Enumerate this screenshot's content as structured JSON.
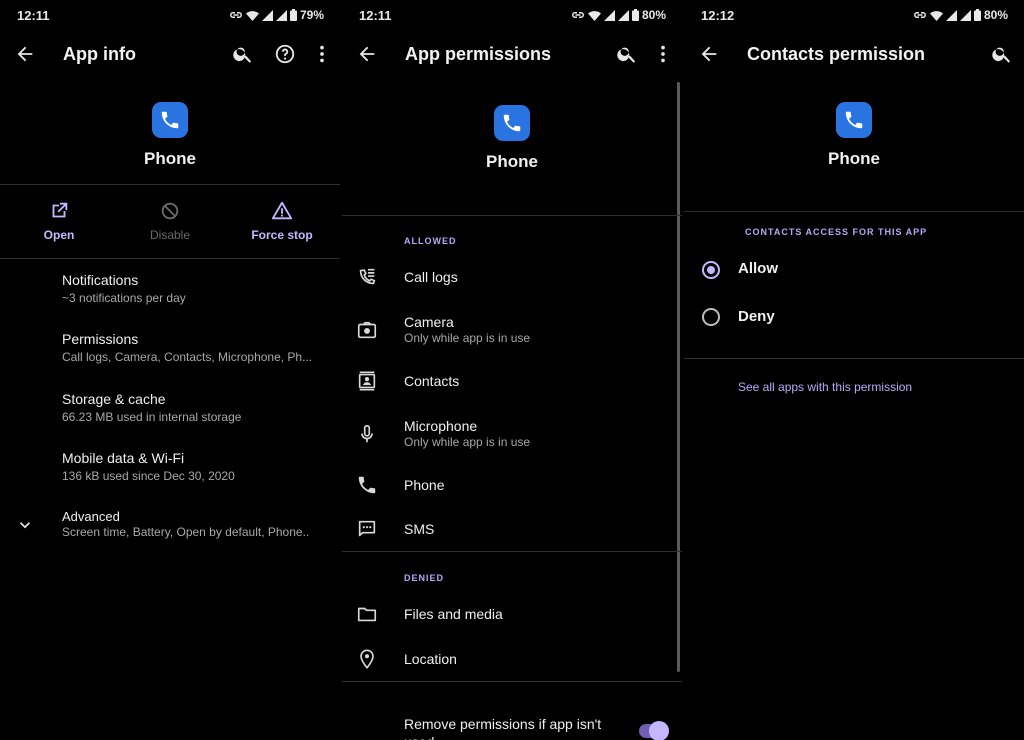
{
  "status_bars": [
    {
      "time": "12:11",
      "battery": "79%"
    },
    {
      "time": "12:11",
      "battery": "80%"
    },
    {
      "time": "12:12",
      "battery": "80%"
    }
  ],
  "colors": {
    "accent": "#c5b6ff",
    "app_icon_bg": "#2a74e2",
    "background": "#000000"
  },
  "app_info": {
    "title": "App info",
    "app_name": "Phone",
    "actions": [
      {
        "label": "Open",
        "icon": "open-external-icon",
        "enabled": true
      },
      {
        "label": "Disable",
        "icon": "disable-icon",
        "enabled": false
      },
      {
        "label": "Force stop",
        "icon": "warning-icon",
        "enabled": true
      }
    ],
    "items": [
      {
        "title": "Notifications",
        "subtitle": "~3 notifications per day"
      },
      {
        "title": "Permissions",
        "subtitle": "Call logs, Camera, Contacts, Microphone, Ph..."
      },
      {
        "title": "Storage & cache",
        "subtitle": "66.23 MB used in internal storage"
      },
      {
        "title": "Mobile data & Wi-Fi",
        "subtitle": "136 kB used since Dec 30, 2020"
      },
      {
        "title": "Advanced",
        "subtitle": "Screen time, Battery, Open by default, Phone.."
      }
    ]
  },
  "app_permissions": {
    "title": "App permissions",
    "app_name": "Phone",
    "allowed_header": "ALLOWED",
    "allowed": [
      {
        "title": "Call logs",
        "subtitle": "",
        "icon": "call-log-icon"
      },
      {
        "title": "Camera",
        "subtitle": "Only while app is in use",
        "icon": "camera-icon"
      },
      {
        "title": "Contacts",
        "subtitle": "",
        "icon": "contacts-icon"
      },
      {
        "title": "Microphone",
        "subtitle": "Only while app is in use",
        "icon": "microphone-icon"
      },
      {
        "title": "Phone",
        "subtitle": "",
        "icon": "phone-icon"
      },
      {
        "title": "SMS",
        "subtitle": "",
        "icon": "sms-icon"
      }
    ],
    "denied_header": "DENIED",
    "denied": [
      {
        "title": "Files and media",
        "icon": "folder-icon"
      },
      {
        "title": "Location",
        "icon": "location-icon"
      }
    ],
    "remove_permissions": {
      "line1": "Remove permissions if app isn't",
      "line2": "used",
      "enabled": true
    }
  },
  "contacts_permission": {
    "title": "Contacts permission",
    "app_name": "Phone",
    "section_header": "CONTACTS ACCESS FOR THIS APP",
    "options": [
      {
        "label": "Allow",
        "selected": true
      },
      {
        "label": "Deny",
        "selected": false
      }
    ],
    "link": "See all apps with this permission"
  }
}
